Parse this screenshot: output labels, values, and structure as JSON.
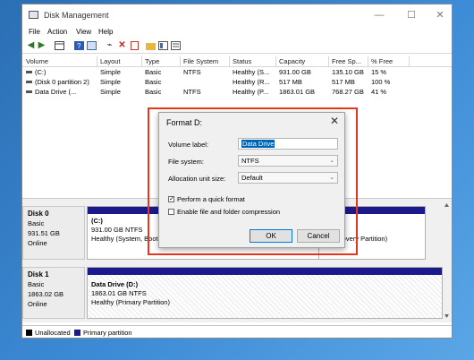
{
  "window": {
    "title": "Disk Management",
    "controls": {
      "minimize": "—",
      "maximize": "☐",
      "close": "✕"
    }
  },
  "menu": [
    "File",
    "Action",
    "View",
    "Help"
  ],
  "toolbar_icons": [
    "back-arrow-icon",
    "forward-arrow-icon",
    "console-tree-icon",
    "help-icon",
    "properties-icon",
    "connect-icon",
    "delete-icon",
    "new-icon",
    "folder-icon",
    "view-icon",
    "list-icon"
  ],
  "volumes": {
    "headers": [
      "Volume",
      "Layout",
      "Type",
      "File System",
      "Status",
      "Capacity",
      "Free Sp...",
      "% Free"
    ],
    "rows": [
      [
        "(C:)",
        "Simple",
        "Basic",
        "NTFS",
        "Healthy (S...",
        "931.00 GB",
        "135.10 GB",
        "15 %"
      ],
      [
        "(Disk 0 partition 2)",
        "Simple",
        "Basic",
        "",
        "Healthy (R...",
        "517 MB",
        "517 MB",
        "100 %"
      ],
      [
        "Data Drive (...",
        "Simple",
        "Basic",
        "NTFS",
        "Healthy (P...",
        "1863.01 GB",
        "768.27 GB",
        "41 %"
      ]
    ]
  },
  "disks": [
    {
      "name": "Disk 0",
      "type": "Basic",
      "size": "931.51 GB",
      "state": "Online",
      "partitions": [
        {
          "label": "(C:)",
          "detail": "931.00 GB NTFS",
          "status": "Healthy (System, Boot,"
        },
        {
          "label": "",
          "detail": "",
          "status": "y (Recovery Partition)"
        }
      ]
    },
    {
      "name": "Disk 1",
      "type": "Basic",
      "size": "1863.02 GB",
      "state": "Online",
      "partitions": [
        {
          "label": "Data Drive  (D:)",
          "detail": "1863.01 GB NTFS",
          "status": "Healthy (Primary Partition)"
        }
      ]
    }
  ],
  "legend": {
    "unallocated": "Unallocated",
    "primary": "Primary partition"
  },
  "colors": {
    "primary_partition": "#1a1a8c",
    "unallocated": "#000000",
    "highlight_box": "#e8361c",
    "selection": "#0063b1"
  },
  "dialog": {
    "title": "Format D:",
    "volume_label": {
      "label": "Volume label:",
      "value": "Data Drive"
    },
    "file_system": {
      "label": "File system:",
      "value": "NTFS"
    },
    "allocation": {
      "label": "Allocation unit size:",
      "value": "Default"
    },
    "quick_format": {
      "label": "Perform a quick format",
      "checked": true,
      "mark": "✓"
    },
    "compression": {
      "label": "Enable file and folder compression",
      "checked": false
    },
    "ok": "OK",
    "cancel": "Cancel",
    "close": "✕"
  }
}
